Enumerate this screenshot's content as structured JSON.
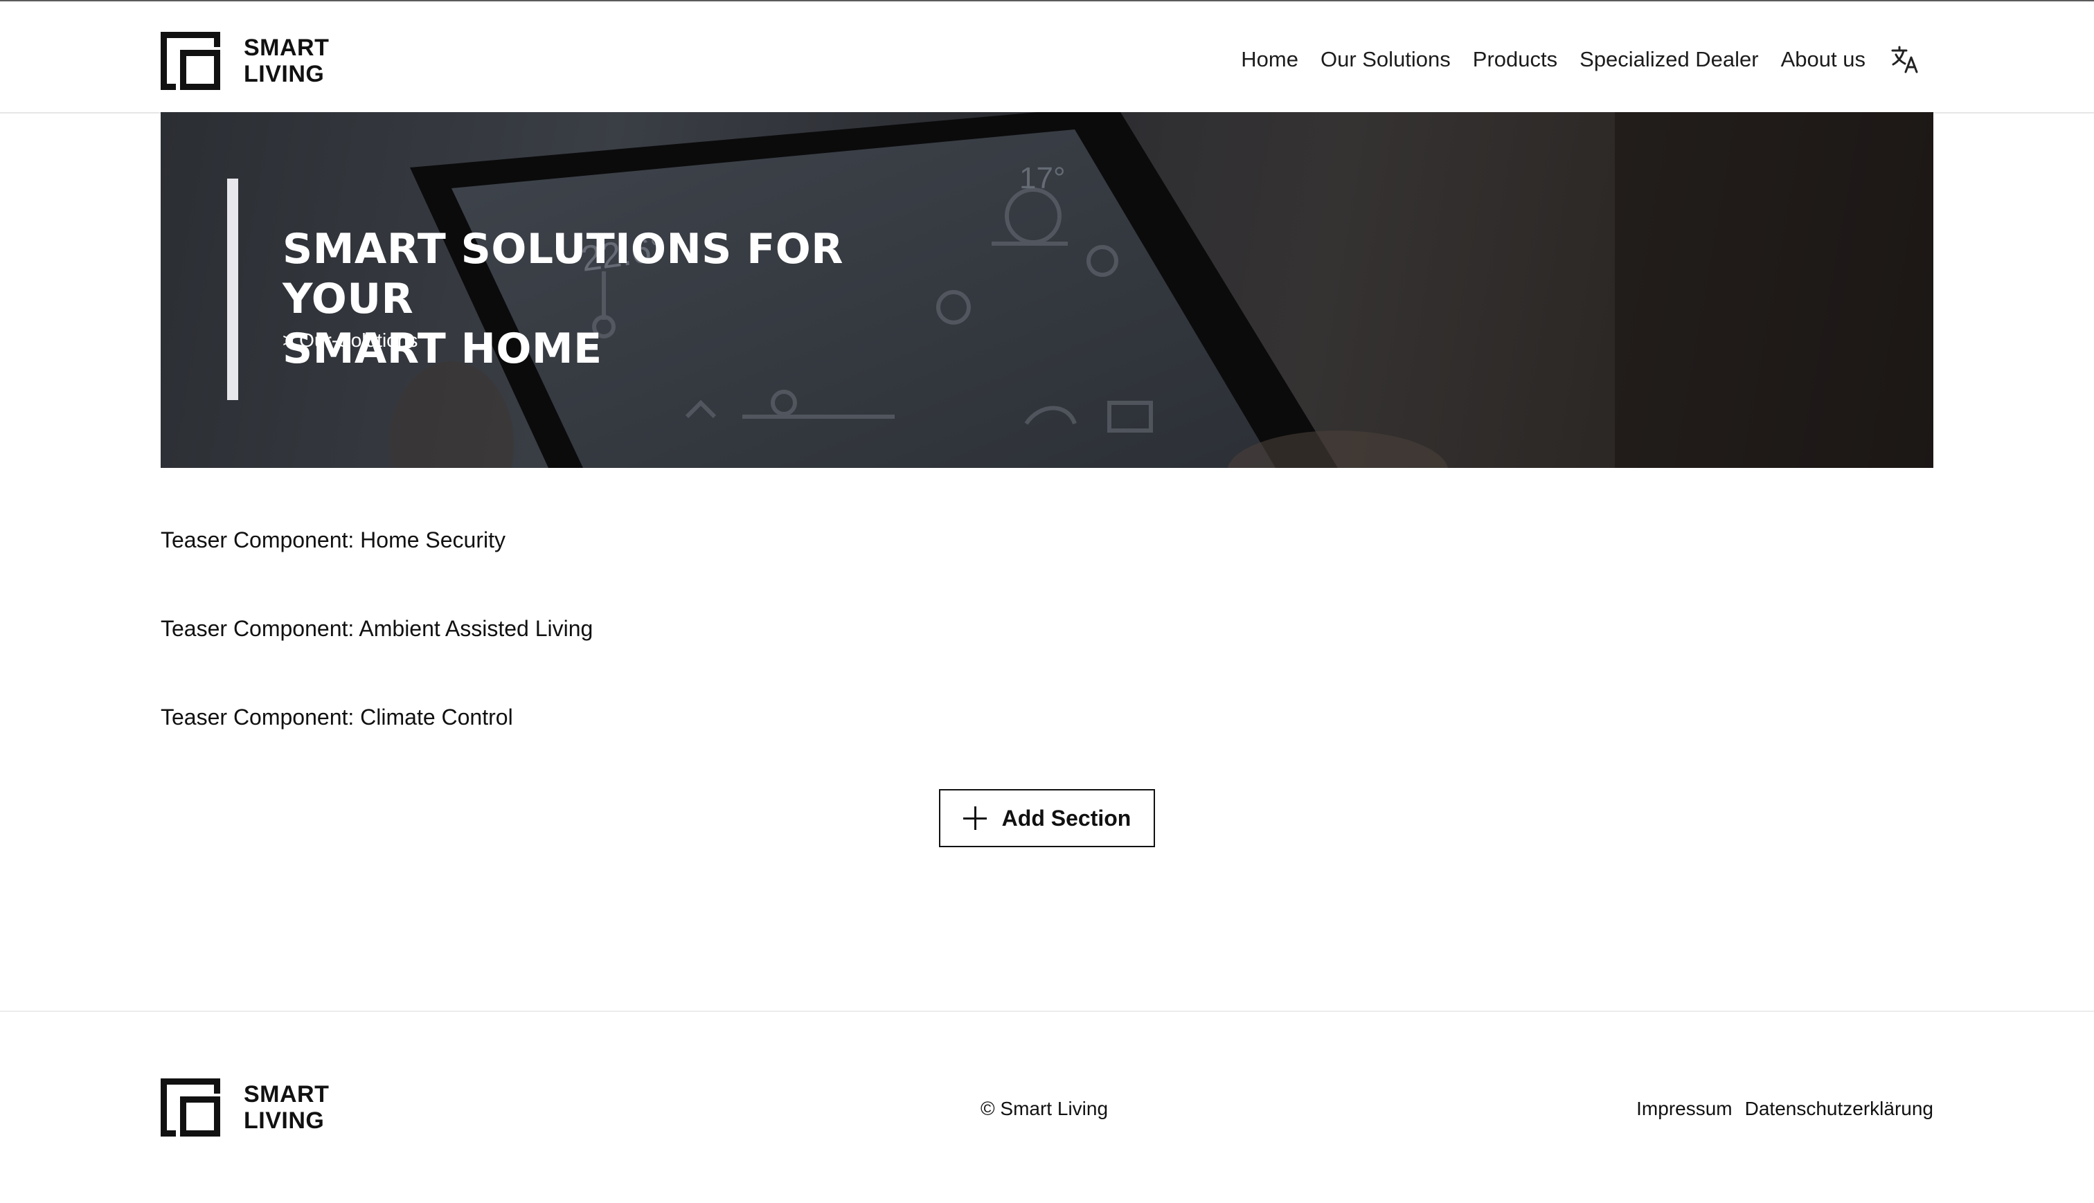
{
  "brand": {
    "line1": "SMART",
    "line2": "LIVING"
  },
  "nav": {
    "items": [
      {
        "label": "Home"
      },
      {
        "label": "Our Solutions"
      },
      {
        "label": "Products"
      },
      {
        "label": "Specialized Dealer"
      },
      {
        "label": "About us"
      }
    ],
    "language_icon": "translate-icon"
  },
  "hero": {
    "title_line1": "SMART SOLUTIONS FOR YOUR",
    "title_line2": "SMART HOME",
    "breadcrumb": "> Our-Solutions"
  },
  "teasers": [
    {
      "label": "Teaser Component: Home Security"
    },
    {
      "label": "Teaser Component: Ambient Assisted Living"
    },
    {
      "label": "Teaser Component: Climate Control"
    }
  ],
  "add_section": {
    "label": "Add Section",
    "icon": "plus-icon"
  },
  "footer": {
    "copyright": "© Smart Living",
    "links": [
      {
        "label": "Impressum"
      },
      {
        "label": "Datenschutzerklärung"
      }
    ]
  },
  "colors": {
    "text": "#111111",
    "hero_overlay": "#2b2e33",
    "accent_bar": "#e8e8ec"
  }
}
